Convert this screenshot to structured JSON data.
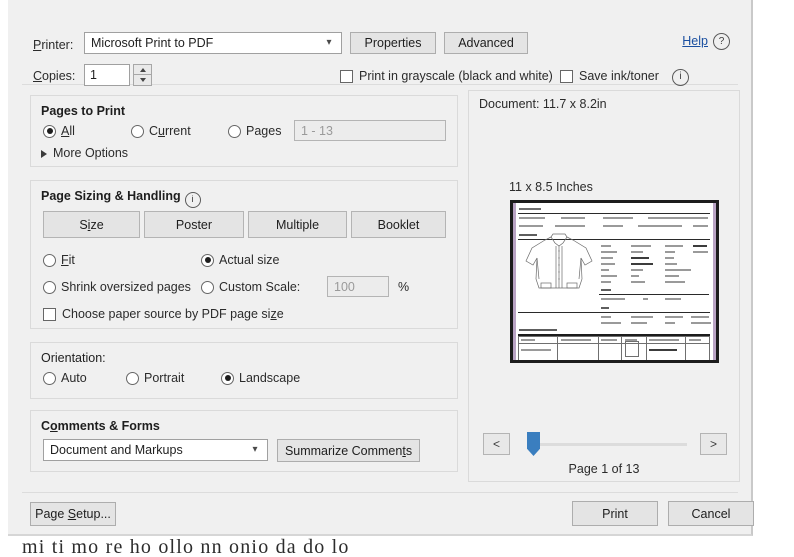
{
  "dialog": {
    "printer": {
      "label": "Printer:",
      "value": "Microsoft Print to PDF",
      "arrow_icon": "chevron-down-icon",
      "properties_label": "Properties",
      "advanced_label": "Advanced",
      "help_label": "Help",
      "help_icon": "question-mark-icon"
    },
    "copies": {
      "label": "Copies:",
      "value": "1",
      "spinner_up_icon": "triangle-up-icon",
      "spinner_down_icon": "triangle-down-icon"
    },
    "grayscale": {
      "label": "Print in grayscale (black and white)",
      "checked": false
    },
    "save_ink": {
      "label": "Save ink/toner",
      "checked": false,
      "info_icon": "info-icon",
      "info_glyph": "i"
    },
    "pages_to_print": {
      "title": "Pages to Print",
      "all_label": "All",
      "current_label": "Current",
      "pages_label": "Pages",
      "range_placeholder": "1 - 13",
      "selected": "All",
      "more_options_label": "More Options",
      "more_options_icon": "triangle-right-icon"
    },
    "page_sizing": {
      "title": "Page Sizing & Handling",
      "info_icon": "info-icon",
      "info_glyph": "i",
      "buttons": [
        {
          "label": "Size"
        },
        {
          "label": "Poster"
        },
        {
          "label": "Multiple"
        },
        {
          "label": "Booklet"
        }
      ],
      "fit_label": "Fit",
      "actual_size_label": "Actual size",
      "shrink_label": "Shrink oversized pages",
      "custom_scale_label": "Custom Scale:",
      "custom_scale_value": "100",
      "percent_label": "%",
      "selected": "Actual size",
      "choose_paper_label": "Choose paper source by PDF page size",
      "choose_paper_checked": false
    },
    "orientation": {
      "title": "Orientation:",
      "auto_label": "Auto",
      "portrait_label": "Portrait",
      "landscape_label": "Landscape",
      "selected": "Landscape"
    },
    "comments_forms": {
      "title": "Comments & Forms",
      "value": "Document and Markups",
      "arrow_icon": "chevron-down-icon",
      "summarize_label": "Summarize Comments"
    },
    "preview": {
      "document_size": "Document: 11.7 x 8.2in",
      "paper_size": "11 x 8.5 Inches",
      "prev_label": "<",
      "next_label": ">",
      "page_indicator": "Page 1 of 13",
      "slider_position_percent": 0
    },
    "footer": {
      "page_setup_label": "Page Setup...",
      "print_label": "Print",
      "cancel_label": "Cancel"
    }
  },
  "background": {
    "text_fragment": "mi ti mo re ho ollo nn onio da do lo"
  },
  "colors": {
    "dialog_bg": "#f0f0f0",
    "button_bg": "#e4e4e4",
    "field_bg": "#ffffff",
    "border": "#a0a0a0",
    "link": "#1a4fa0",
    "slider_accent": "#3a7ebf",
    "text": "#2b2b2b"
  }
}
